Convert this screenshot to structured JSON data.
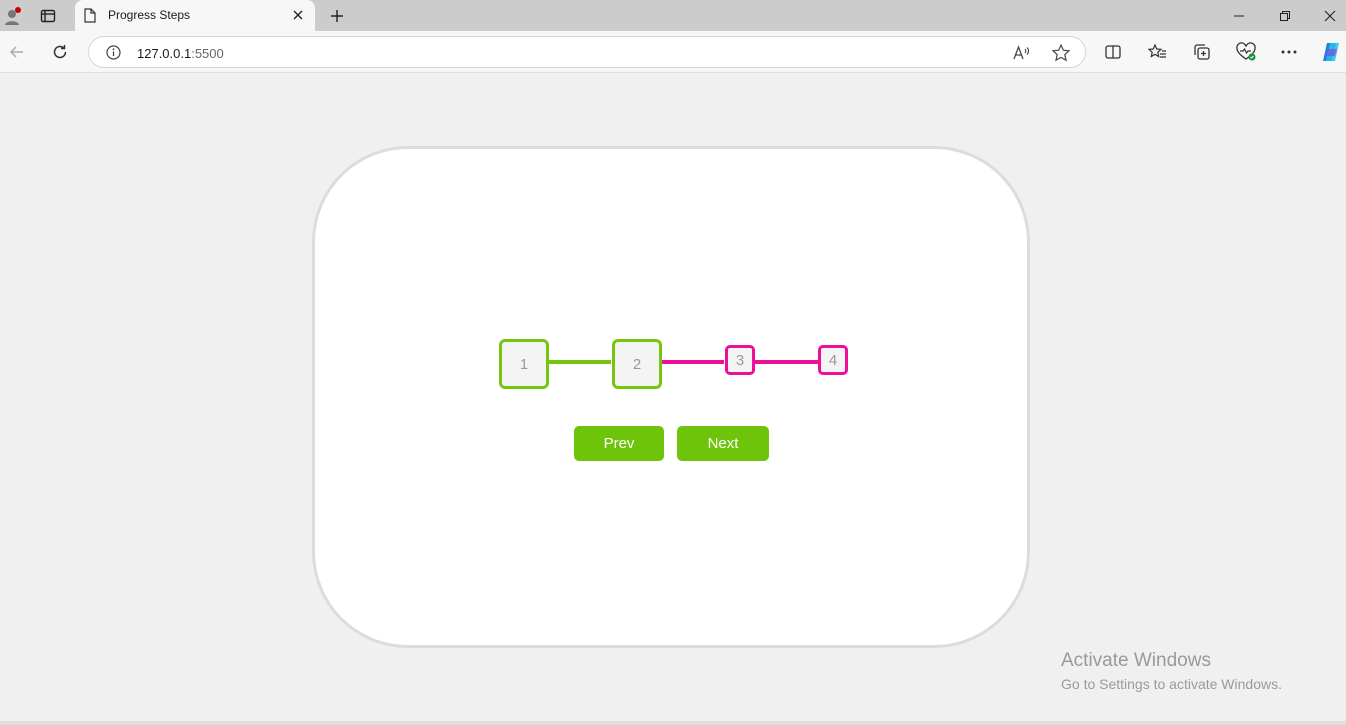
{
  "browser": {
    "tab_title": "Progress Steps",
    "url_host": "127.0.0.1",
    "url_port": ":5500"
  },
  "progress": {
    "steps": [
      "1",
      "2",
      "3",
      "4"
    ],
    "active_steps": 2,
    "active_color": "#76c60f",
    "inactive_color": "#ee0e9b"
  },
  "controls": {
    "prev_label": "Prev",
    "next_label": "Next",
    "button_color": "#6dc40a"
  },
  "watermark": {
    "title": "Activate Windows",
    "subtitle": "Go to Settings to activate Windows."
  }
}
